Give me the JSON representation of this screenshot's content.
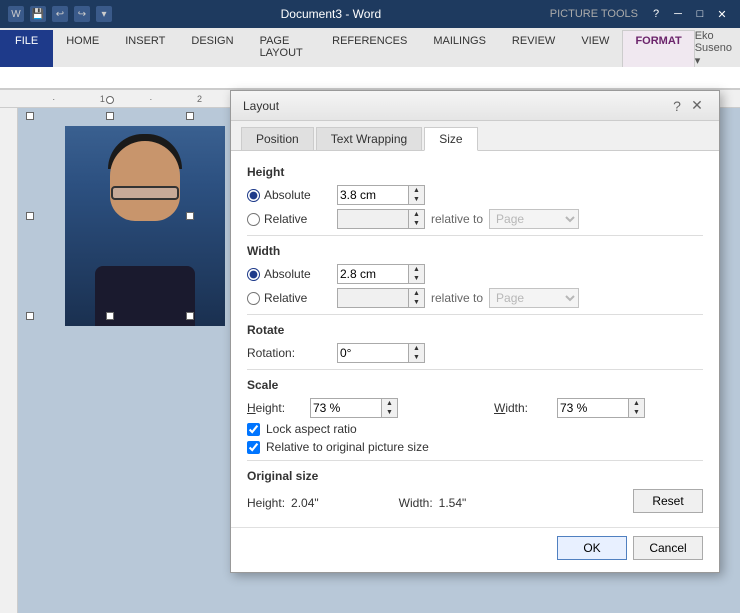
{
  "titleBar": {
    "appName": "Document3 - Word",
    "pictureTools": "PICTURE TOOLS",
    "helpBtn": "?",
    "minBtn": "─",
    "maxBtn": "□",
    "closeBtn": "✕"
  },
  "ribbon": {
    "tabs": [
      "FILE",
      "HOME",
      "INSERT",
      "DESIGN",
      "PAGE LAYOUT",
      "REFERENCES",
      "MAILINGS",
      "REVIEW",
      "VIEW"
    ],
    "activeTab": "FORMAT",
    "user": "Eko Suseno ▾"
  },
  "dialog": {
    "title": "Layout",
    "helpBtn": "?",
    "closeBtn": "✕",
    "tabs": [
      "Position",
      "Text Wrapping",
      "Size"
    ],
    "activeTab": "Size",
    "sections": {
      "height": {
        "label": "Height",
        "absoluteLabel": "Absolute",
        "absoluteValue": "3.8 cm",
        "relativeLabel": "Relative",
        "relativeValue": "",
        "relativeToLabel": "relative to",
        "relativeToValue": "Page"
      },
      "width": {
        "label": "Width",
        "absoluteLabel": "Absolute",
        "absoluteValue": "2.8 cm",
        "relativeLabel": "Relative",
        "relativeValue": "",
        "relativeToLabel": "relative to",
        "relativeToValue": "Page"
      },
      "rotate": {
        "label": "Rotate",
        "rotationLabel": "Rotation:",
        "rotationValue": "0°"
      },
      "scale": {
        "label": "Scale",
        "heightLabel": "Height:",
        "heightValue": "73 %",
        "widthLabel": "Width:",
        "widthValue": "73 %",
        "lockAspectRatio": "Lock aspect ratio",
        "relativeToOriginal": "Relative to original picture size"
      },
      "originalSize": {
        "label": "Original size",
        "heightLabel": "Height:",
        "heightValue": "2.04\"",
        "widthLabel": "Width:",
        "widthValue": "1.54\"",
        "resetBtn": "Reset"
      }
    },
    "okBtn": "OK",
    "cancelBtn": "Cancel"
  }
}
